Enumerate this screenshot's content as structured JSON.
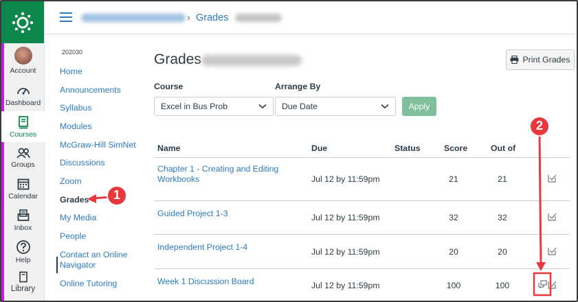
{
  "global_nav": {
    "items": [
      {
        "label": "Account",
        "icon": "avatar"
      },
      {
        "label": "Dashboard",
        "icon": "dashboard-icon"
      },
      {
        "label": "Courses",
        "icon": "courses-icon"
      },
      {
        "label": "Groups",
        "icon": "groups-icon"
      },
      {
        "label": "Calendar",
        "icon": "calendar-icon"
      },
      {
        "label": "Inbox",
        "icon": "inbox-icon"
      },
      {
        "label": "Help",
        "icon": "help-icon"
      },
      {
        "label": "Library",
        "icon": "library-icon"
      }
    ],
    "active": "Courses"
  },
  "breadcrumb": {
    "separator": "›",
    "current": "Grades"
  },
  "course_nav": {
    "term": "202030",
    "items": [
      "Home",
      "Announcements",
      "Syllabus",
      "Modules",
      "McGraw-Hill SimNet",
      "Discussions",
      "Zoom",
      "Grades",
      "My Media",
      "People",
      "Contact an Online Navigator",
      "Online Tutoring"
    ],
    "active": "Grades"
  },
  "page": {
    "title": "Grades"
  },
  "print_button": {
    "label": "Print Grades"
  },
  "filters": {
    "course_label": "Course",
    "course_value": "Excel in Bus Prob",
    "arrange_label": "Arrange By",
    "arrange_value": "Due Date",
    "apply_label": "Apply"
  },
  "table": {
    "headers": {
      "name": "Name",
      "due": "Due",
      "status": "Status",
      "score": "Score",
      "out_of": "Out of"
    },
    "rows": [
      {
        "name": "Chapter 1 - Creating and Editing Workbooks",
        "due": "Jul 12 by 11:59pm",
        "status": "",
        "score": "21",
        "out_of": "21"
      },
      {
        "name": "Guided Project 1-3",
        "due": "Jul 12 by 11:59pm",
        "status": "",
        "score": "32",
        "out_of": "32"
      },
      {
        "name": "Independent Project 1-4",
        "due": "Jul 12 by 11:59pm",
        "status": "",
        "score": "20",
        "out_of": "20"
      },
      {
        "name": "Week 1 Discussion Board",
        "due": "Jul 12 by 11:59pm",
        "status": "",
        "score": "100",
        "out_of": "100"
      }
    ]
  },
  "annotations": {
    "step1": "1",
    "step2": "2",
    "color": "#e8383d"
  },
  "colors": {
    "brand": "#0b874b",
    "link": "#2b7abc",
    "text": "#2d3b45",
    "apply": "#7fbf9a"
  }
}
